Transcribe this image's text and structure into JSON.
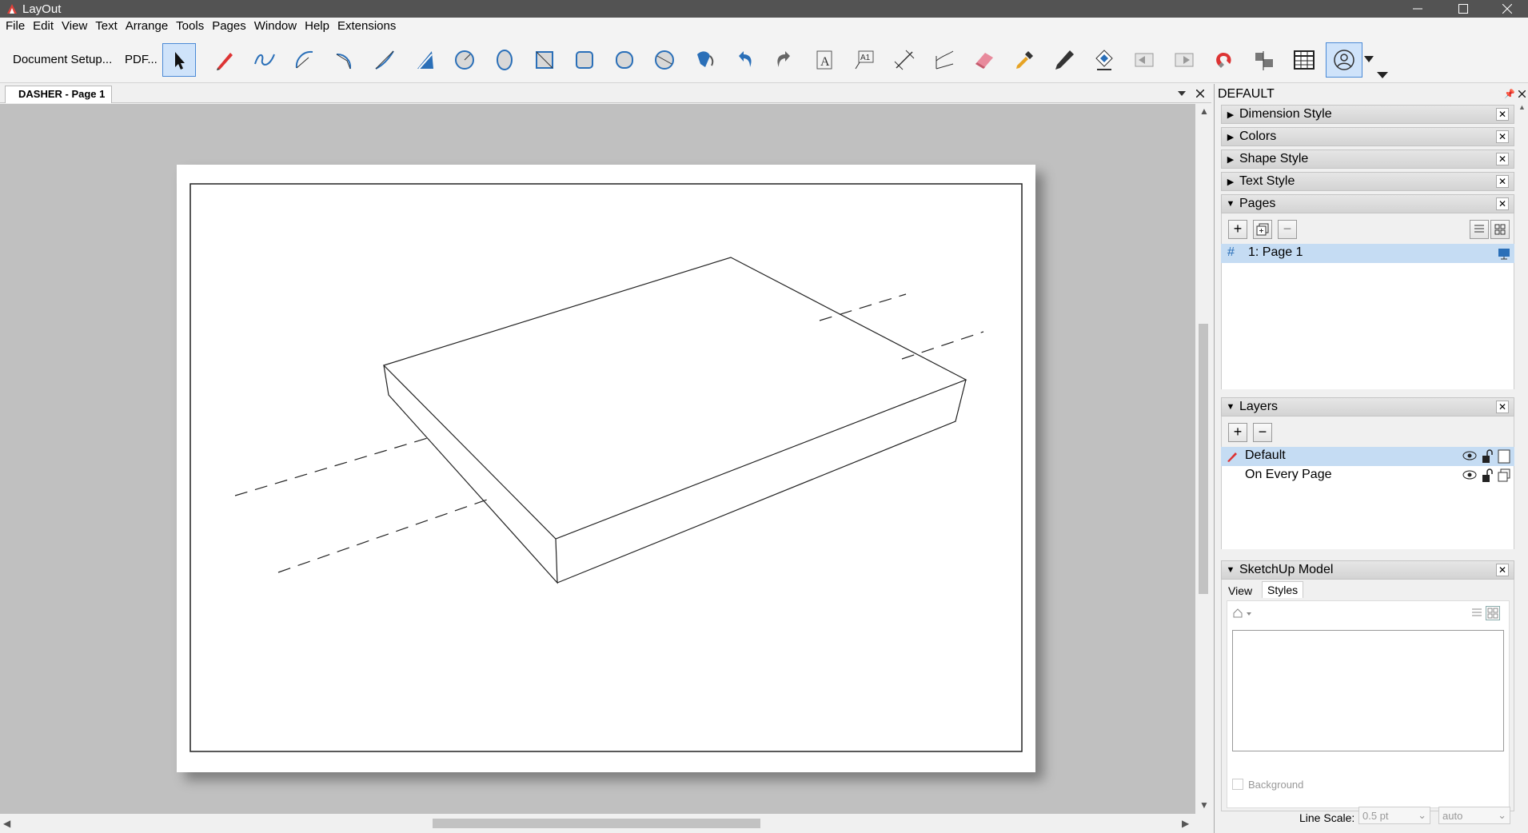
{
  "window": {
    "title": "LayOut"
  },
  "menu": [
    "File",
    "Edit",
    "View",
    "Text",
    "Arrange",
    "Tools",
    "Pages",
    "Window",
    "Help",
    "Extensions"
  ],
  "toolbar": {
    "document_setup": "Document Setup...",
    "pdf": "PDF..."
  },
  "doc_tab": {
    "label": "DASHER - Page 1"
  },
  "tray": {
    "title": "DEFAULT",
    "panels": {
      "dimension_style": "Dimension Style",
      "colors": "Colors",
      "shape_style": "Shape Style",
      "text_style": "Text Style",
      "pages": "Pages",
      "layers": "Layers",
      "sketchup_model": "SketchUp Model"
    },
    "pages_list": [
      {
        "label": "1: Page 1"
      }
    ],
    "layers_list": [
      {
        "label": "Default"
      },
      {
        "label": "On Every Page"
      }
    ],
    "sketchup": {
      "tabs": [
        "View",
        "Styles"
      ],
      "background_label": "Background",
      "line_scale_label": "Line Scale:",
      "line_scale_value": "0.5 pt",
      "auto_value": "auto"
    }
  },
  "icons": [
    "select-arrow-icon",
    "pencil-icon",
    "freehand-icon",
    "arc-icon",
    "pie-icon",
    "line-icon",
    "offset-icon",
    "circle-icon",
    "ellipse-icon",
    "rectangle-icon",
    "rounded-rectangle-icon",
    "lozenge-icon",
    "polygon-icon",
    "paint-icon",
    "undo-icon",
    "redo-icon",
    "text-icon",
    "label-icon",
    "linear-dimension-icon",
    "angular-dimension-icon",
    "eraser-icon",
    "eyedropper-icon",
    "pen-icon",
    "split-icon",
    "previous-page-icon",
    "next-page-icon",
    "magnet-icon",
    "scrapbook-icon",
    "table-icon",
    "presentation-icon"
  ]
}
